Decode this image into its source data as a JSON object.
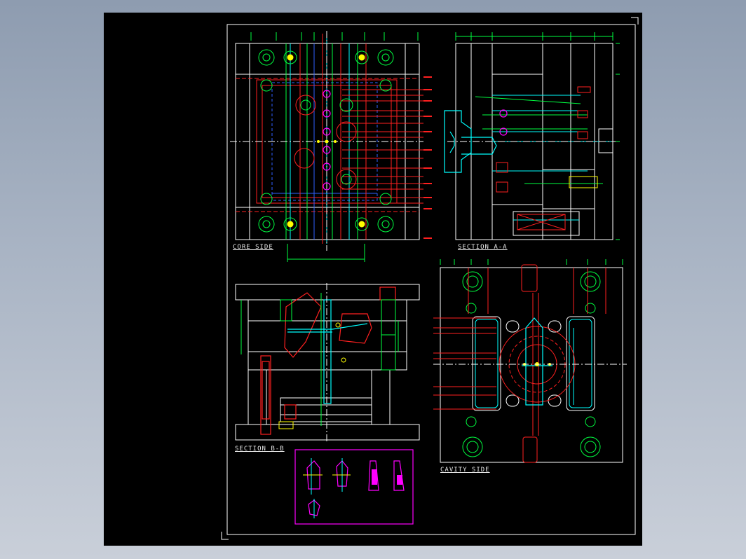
{
  "app": {
    "background_gradient": [
      "#8e9cb0",
      "#c9cfd9"
    ],
    "canvas_color": "#000000"
  },
  "views": {
    "core_side": {
      "title": "CORE SIDE"
    },
    "section_aa": {
      "title": "SECTION A-A"
    },
    "section_bb": {
      "title": "SECTION B-B"
    },
    "cavity_side": {
      "title": "CAVITY SIDE"
    }
  },
  "palette": {
    "outline": "#ffffff",
    "red": "#ff2020",
    "green": "#00ff40",
    "cyan": "#00ffff",
    "yellow": "#ffff00",
    "magenta": "#ff00ff",
    "blue": "#3060ff",
    "dimension": "#b0b0b0"
  },
  "icons": {
    "core_side_bolts": "bolt-circle-icon",
    "sprue_pin": "sprue-pin-icon",
    "detail_parts": "ejector-detail-icon"
  }
}
